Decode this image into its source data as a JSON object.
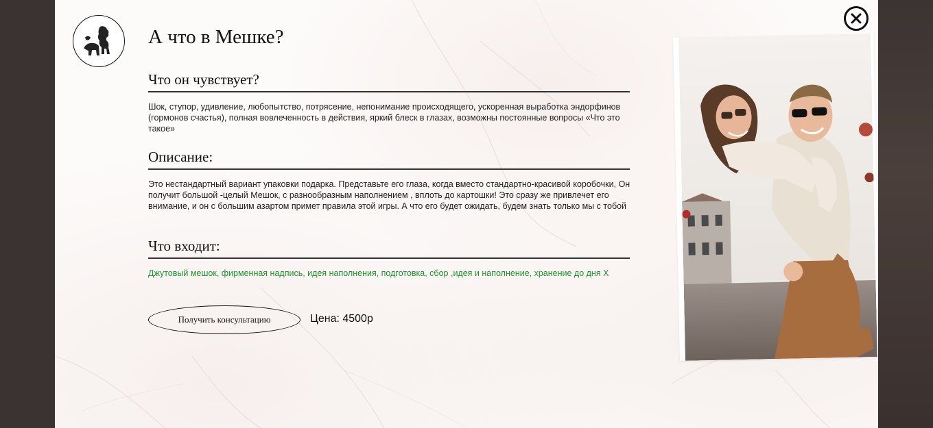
{
  "modal": {
    "title": "А что в Мешке?",
    "feels": {
      "heading": "Что он чувствует?",
      "text": "Шок, ступор, удивление, любопытство, потрясение, непонимание происходящего, ускоренная выработка эндорфинов (гормонов счастья), полная вовлеченность в действия, яркий блеск в глазах, возможны постоянные вопросы «Что это такое»"
    },
    "description": {
      "heading": "Описание:",
      "text": "Это нестандартный вариант упаковки подарка. Представьте его глаза, когда вместо стандартно-красивой коробочки, Он получит большой -целый Мешок, с разнообразным наполнением , вплоть до картошки! Это сразу же привлечет его внимание, и он с большим азартом примет правила этой игры. А что его будет ожидать, будем знать только мы с тобой"
    },
    "includes": {
      "heading": "Что входит:",
      "text": "Джутовый мешок, фирменная надпись, идея наполнения, подготовка, сбор ,идея и наполнение, хранение до дня Х"
    },
    "consult_button": "Получить консультацию",
    "price": "Цена: 4500р"
  },
  "icons": {
    "logo": "lion-bear-logo-icon",
    "close": "close-icon"
  },
  "colors": {
    "accent_green": "#1a9a2a",
    "overlay": "#3b3331"
  }
}
